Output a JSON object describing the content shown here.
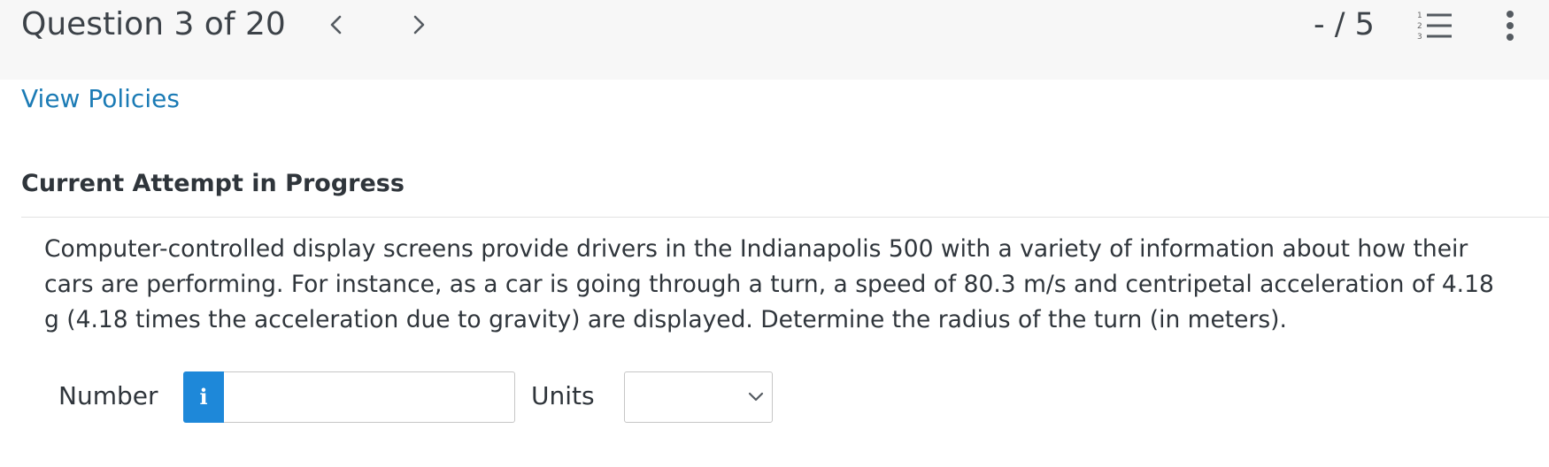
{
  "header": {
    "question_counter": "Question 3 of 20",
    "score": "- / 5",
    "icons": {
      "prev": "chevron-left-icon",
      "next": "chevron-right-icon",
      "list": "numbered-list-icon",
      "more": "more-vertical-icon"
    }
  },
  "links": {
    "view_policies": "View Policies"
  },
  "section": {
    "title": "Current Attempt in Progress"
  },
  "question": {
    "text": "Computer-controlled display screens provide drivers in the Indianapolis 500 with a variety of information about how their cars are performing. For instance, as a car is going through a turn, a speed of 80.3 m/s and centripetal acceleration of 4.18 g (4.18 times the acceleration due to gravity) are displayed. Determine the radius of the turn (in meters)."
  },
  "answer": {
    "number_label": "Number",
    "info_glyph": "i",
    "number_value": "",
    "units_label": "Units",
    "units_selected": ""
  },
  "colors": {
    "link": "#1b7bb5",
    "info_button": "#1e88d9",
    "topbar_bg": "#f7f7f7"
  }
}
